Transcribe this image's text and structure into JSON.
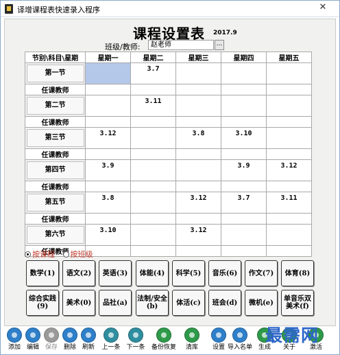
{
  "window": {
    "title": "译增课程表快速录入程序",
    "close_glyph": "✕"
  },
  "heading": {
    "title": "课程设置表",
    "year": "2017.9"
  },
  "class_selector": {
    "label": "班级/教师:",
    "value": "赵老师",
    "browse_label": "..."
  },
  "timetable": {
    "corner_header": "节别\\科目\\星期",
    "days": [
      "星期一",
      "星期二",
      "星期三",
      "星期四",
      "星期五"
    ],
    "teacher_label": "任课教师",
    "periods": [
      {
        "name": "第一节",
        "cells": [
          "",
          "3.7",
          "",
          "",
          ""
        ]
      },
      {
        "name": "第二节",
        "cells": [
          "",
          "3.11",
          "",
          "",
          ""
        ]
      },
      {
        "name": "第三节",
        "cells": [
          "3.12",
          "",
          "3.8",
          "3.10",
          ""
        ]
      },
      {
        "name": "第四节",
        "cells": [
          "3.9",
          "",
          "",
          "3.9",
          "3.12"
        ]
      },
      {
        "name": "第五节",
        "cells": [
          "3.8",
          "",
          "3.12",
          "3.7",
          "3.11"
        ]
      },
      {
        "name": "第六节",
        "cells": [
          "3.10",
          "",
          "3.12",
          "",
          ""
        ]
      }
    ]
  },
  "mode": {
    "options": [
      {
        "label": "按课程",
        "selected": true
      },
      {
        "label": "按班级",
        "selected": false
      }
    ]
  },
  "subjects": {
    "row1": [
      "数学(1)",
      "语文(2)",
      "英语(3)",
      "体能(4)",
      "科学(5)",
      "音乐(6)",
      "作文(7)",
      "体育(8)"
    ],
    "row2": [
      "综合实践(9)",
      "美术(0)",
      "品社(a)",
      "法制/安全(b)",
      "体活(c)",
      "班会(d)",
      "微机(e)",
      "单音乐双美术(f)"
    ]
  },
  "toolbar": {
    "buttons": [
      {
        "label": "添加",
        "icon": "add-icon"
      },
      {
        "label": "编辑",
        "icon": "edit-icon"
      },
      {
        "label": "保存",
        "icon": "save-icon"
      },
      {
        "label": "删除",
        "icon": "delete-icon"
      },
      {
        "label": "刷新",
        "icon": "refresh-icon"
      },
      {
        "label": "上一条",
        "icon": "previous-icon"
      },
      {
        "label": "下一条",
        "icon": "next-icon"
      },
      {
        "label": "备份恢复",
        "icon": "backup-icon"
      },
      {
        "label": "清库",
        "icon": "clear-icon"
      },
      {
        "label": "设置",
        "icon": "settings-icon"
      },
      {
        "label": "导入名单",
        "icon": "import-icon"
      },
      {
        "label": "生成",
        "icon": "generate-icon"
      },
      {
        "label": "关于",
        "icon": "about-icon"
      },
      {
        "label": "激活",
        "icon": "activate-icon"
      }
    ]
  },
  "watermark": "最需网",
  "colors": {
    "selected_cell": "#b4c8ea",
    "radio_label": "#c0392b",
    "toolbar_icon": "#2f7fc9",
    "watermark": "#2d66c9"
  }
}
